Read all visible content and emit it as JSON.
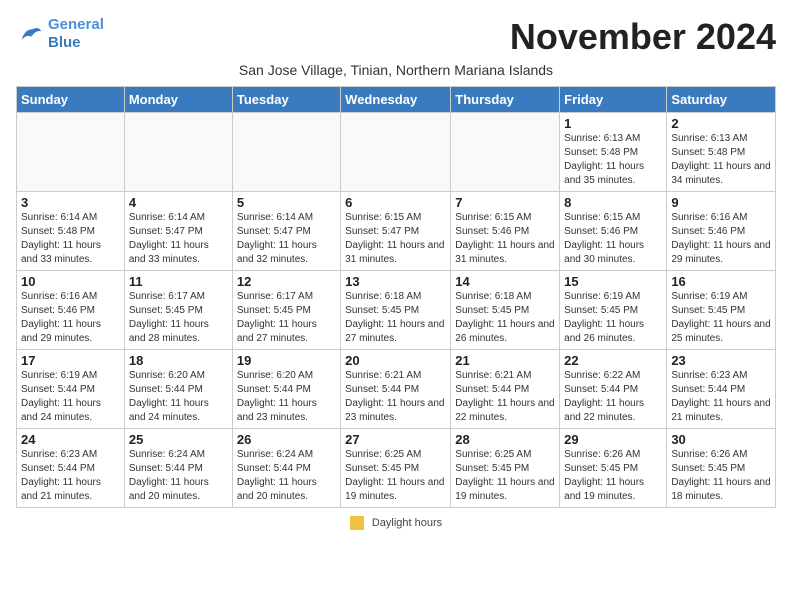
{
  "header": {
    "logo_line1": "General",
    "logo_line2": "Blue",
    "month_title": "November 2024",
    "subtitle": "San Jose Village, Tinian, Northern Mariana Islands"
  },
  "weekdays": [
    "Sunday",
    "Monday",
    "Tuesday",
    "Wednesday",
    "Thursday",
    "Friday",
    "Saturday"
  ],
  "weeks": [
    [
      {
        "day": "",
        "info": ""
      },
      {
        "day": "",
        "info": ""
      },
      {
        "day": "",
        "info": ""
      },
      {
        "day": "",
        "info": ""
      },
      {
        "day": "",
        "info": ""
      },
      {
        "day": "1",
        "info": "Sunrise: 6:13 AM\nSunset: 5:48 PM\nDaylight: 11 hours and 35 minutes."
      },
      {
        "day": "2",
        "info": "Sunrise: 6:13 AM\nSunset: 5:48 PM\nDaylight: 11 hours and 34 minutes."
      }
    ],
    [
      {
        "day": "3",
        "info": "Sunrise: 6:14 AM\nSunset: 5:48 PM\nDaylight: 11 hours and 33 minutes."
      },
      {
        "day": "4",
        "info": "Sunrise: 6:14 AM\nSunset: 5:47 PM\nDaylight: 11 hours and 33 minutes."
      },
      {
        "day": "5",
        "info": "Sunrise: 6:14 AM\nSunset: 5:47 PM\nDaylight: 11 hours and 32 minutes."
      },
      {
        "day": "6",
        "info": "Sunrise: 6:15 AM\nSunset: 5:47 PM\nDaylight: 11 hours and 31 minutes."
      },
      {
        "day": "7",
        "info": "Sunrise: 6:15 AM\nSunset: 5:46 PM\nDaylight: 11 hours and 31 minutes."
      },
      {
        "day": "8",
        "info": "Sunrise: 6:15 AM\nSunset: 5:46 PM\nDaylight: 11 hours and 30 minutes."
      },
      {
        "day": "9",
        "info": "Sunrise: 6:16 AM\nSunset: 5:46 PM\nDaylight: 11 hours and 29 minutes."
      }
    ],
    [
      {
        "day": "10",
        "info": "Sunrise: 6:16 AM\nSunset: 5:46 PM\nDaylight: 11 hours and 29 minutes."
      },
      {
        "day": "11",
        "info": "Sunrise: 6:17 AM\nSunset: 5:45 PM\nDaylight: 11 hours and 28 minutes."
      },
      {
        "day": "12",
        "info": "Sunrise: 6:17 AM\nSunset: 5:45 PM\nDaylight: 11 hours and 27 minutes."
      },
      {
        "day": "13",
        "info": "Sunrise: 6:18 AM\nSunset: 5:45 PM\nDaylight: 11 hours and 27 minutes."
      },
      {
        "day": "14",
        "info": "Sunrise: 6:18 AM\nSunset: 5:45 PM\nDaylight: 11 hours and 26 minutes."
      },
      {
        "day": "15",
        "info": "Sunrise: 6:19 AM\nSunset: 5:45 PM\nDaylight: 11 hours and 26 minutes."
      },
      {
        "day": "16",
        "info": "Sunrise: 6:19 AM\nSunset: 5:45 PM\nDaylight: 11 hours and 25 minutes."
      }
    ],
    [
      {
        "day": "17",
        "info": "Sunrise: 6:19 AM\nSunset: 5:44 PM\nDaylight: 11 hours and 24 minutes."
      },
      {
        "day": "18",
        "info": "Sunrise: 6:20 AM\nSunset: 5:44 PM\nDaylight: 11 hours and 24 minutes."
      },
      {
        "day": "19",
        "info": "Sunrise: 6:20 AM\nSunset: 5:44 PM\nDaylight: 11 hours and 23 minutes."
      },
      {
        "day": "20",
        "info": "Sunrise: 6:21 AM\nSunset: 5:44 PM\nDaylight: 11 hours and 23 minutes."
      },
      {
        "day": "21",
        "info": "Sunrise: 6:21 AM\nSunset: 5:44 PM\nDaylight: 11 hours and 22 minutes."
      },
      {
        "day": "22",
        "info": "Sunrise: 6:22 AM\nSunset: 5:44 PM\nDaylight: 11 hours and 22 minutes."
      },
      {
        "day": "23",
        "info": "Sunrise: 6:23 AM\nSunset: 5:44 PM\nDaylight: 11 hours and 21 minutes."
      }
    ],
    [
      {
        "day": "24",
        "info": "Sunrise: 6:23 AM\nSunset: 5:44 PM\nDaylight: 11 hours and 21 minutes."
      },
      {
        "day": "25",
        "info": "Sunrise: 6:24 AM\nSunset: 5:44 PM\nDaylight: 11 hours and 20 minutes."
      },
      {
        "day": "26",
        "info": "Sunrise: 6:24 AM\nSunset: 5:44 PM\nDaylight: 11 hours and 20 minutes."
      },
      {
        "day": "27",
        "info": "Sunrise: 6:25 AM\nSunset: 5:45 PM\nDaylight: 11 hours and 19 minutes."
      },
      {
        "day": "28",
        "info": "Sunrise: 6:25 AM\nSunset: 5:45 PM\nDaylight: 11 hours and 19 minutes."
      },
      {
        "day": "29",
        "info": "Sunrise: 6:26 AM\nSunset: 5:45 PM\nDaylight: 11 hours and 19 minutes."
      },
      {
        "day": "30",
        "info": "Sunrise: 6:26 AM\nSunset: 5:45 PM\nDaylight: 11 hours and 18 minutes."
      }
    ]
  ],
  "legend": {
    "box_label": "Daylight hours"
  }
}
